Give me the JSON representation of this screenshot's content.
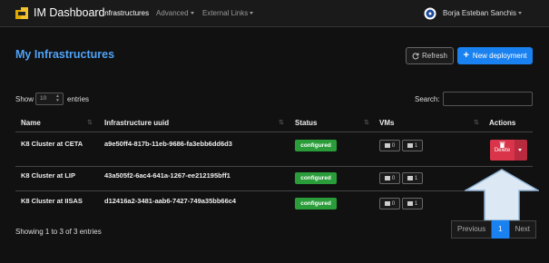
{
  "navbar": {
    "brand": "IM Dashboard",
    "items": [
      {
        "label": "Infrastructures",
        "active": true,
        "dropdown": false
      },
      {
        "label": "Advanced",
        "active": false,
        "dropdown": true
      },
      {
        "label": "External Links",
        "active": false,
        "dropdown": true
      }
    ],
    "user_name": "Borja Esteban Sanchis"
  },
  "page": {
    "title": "My Infrastructures",
    "refresh_label": "Refresh",
    "new_label": "New deployment"
  },
  "table_controls": {
    "show_label": "Show",
    "length_value": "10",
    "entries_label": "entries",
    "search_label": "Search:",
    "search_value": ""
  },
  "table": {
    "columns": [
      "Name",
      "Infrastructure uuid",
      "Status",
      "VMs",
      "Actions"
    ],
    "rows": [
      {
        "name": "K8 Cluster at CETA",
        "uuid": "a9e50ff4-817b-11eb-9686-fa3ebb6dd6d3",
        "status": "configured",
        "vm_a": "0",
        "vm_b": "1"
      },
      {
        "name": "K8 Cluster at LIP",
        "uuid": "43a505f2-6ac4-641a-1267-ee212195bff1",
        "status": "configured",
        "vm_a": "0",
        "vm_b": "1"
      },
      {
        "name": "K8 Cluster at IISAS",
        "uuid": "d12416a2-3481-aab6-7427-749a35bb66c4",
        "status": "configured",
        "vm_a": "0",
        "vm_b": "1"
      }
    ],
    "delete_label": "Delete"
  },
  "footer": {
    "info": "Showing 1 to 3 of 3 entries",
    "previous": "Previous",
    "page": "1",
    "next": "Next"
  },
  "colors": {
    "accent": "#1a82f0",
    "title": "#4fa3f7",
    "status_ok": "#2a9d3a",
    "danger": "#d9344a",
    "arrow_fill": "#dce9f5",
    "arrow_stroke": "#8fb2d4"
  },
  "icons": {
    "brand": "cloud-logo-icon",
    "refresh": "refresh-icon",
    "new": "plus-icon",
    "user": "egi-logo-icon",
    "vm": "server-icon",
    "delete": "trash-icon",
    "overlay": "up-arrow-icon"
  }
}
